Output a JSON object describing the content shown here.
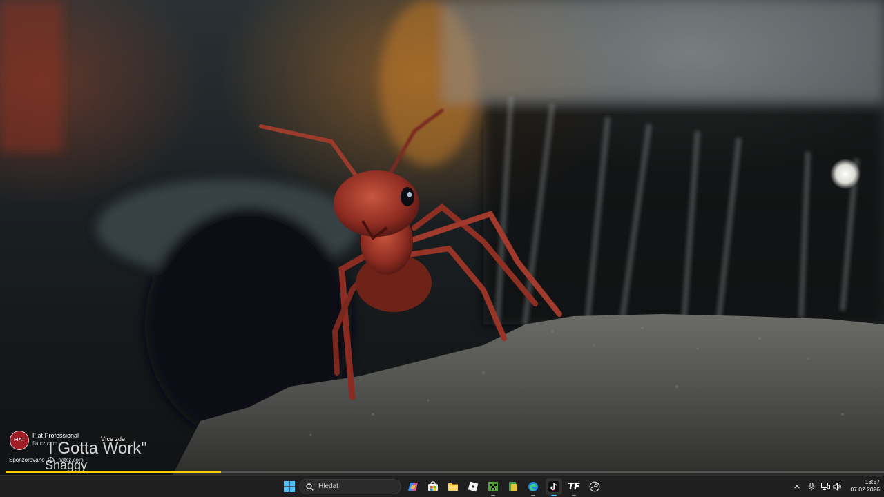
{
  "ad": {
    "logo_text": "FIAT",
    "title": "Fiat Professional",
    "domain": "fiatcz.com",
    "cta_label": "Více zde",
    "sponsored_label": "Sponzorováno",
    "sponsored_domain": "fiatcz.com"
  },
  "song": {
    "title": "I Gotta Work\"",
    "artist": "Shaggy"
  },
  "playback": {
    "progress": 0.245,
    "progress_color": "#ffcc00"
  },
  "taskbar": {
    "search_placeholder": "Hledat",
    "pinned": [
      {
        "name": "start-button",
        "icon": "windows-logo-icon"
      },
      {
        "name": "copilot-button",
        "icon": "copilot-icon"
      },
      {
        "name": "store-button",
        "icon": "microsoft-store-icon"
      },
      {
        "name": "file-explorer-button",
        "icon": "folder-icon"
      },
      {
        "name": "roblox-button",
        "icon": "roblox-icon"
      },
      {
        "name": "minecraft-button",
        "icon": "minecraft-icon"
      },
      {
        "name": "launcher-button",
        "icon": "launcher-icon"
      },
      {
        "name": "edge-button",
        "icon": "edge-icon"
      },
      {
        "name": "tiktok-button",
        "icon": "tiktok-icon"
      },
      {
        "name": "tf-app-button",
        "icon": "tf-icon"
      },
      {
        "name": "steam-button",
        "icon": "steam-icon"
      }
    ],
    "tf_icon_text": "TF",
    "time": "18:57",
    "date": "07.02.2026"
  },
  "colors": {
    "taskbar_bg": "#1f1f1f",
    "accent": "#60cdff",
    "fiat_red": "#a01d26"
  }
}
